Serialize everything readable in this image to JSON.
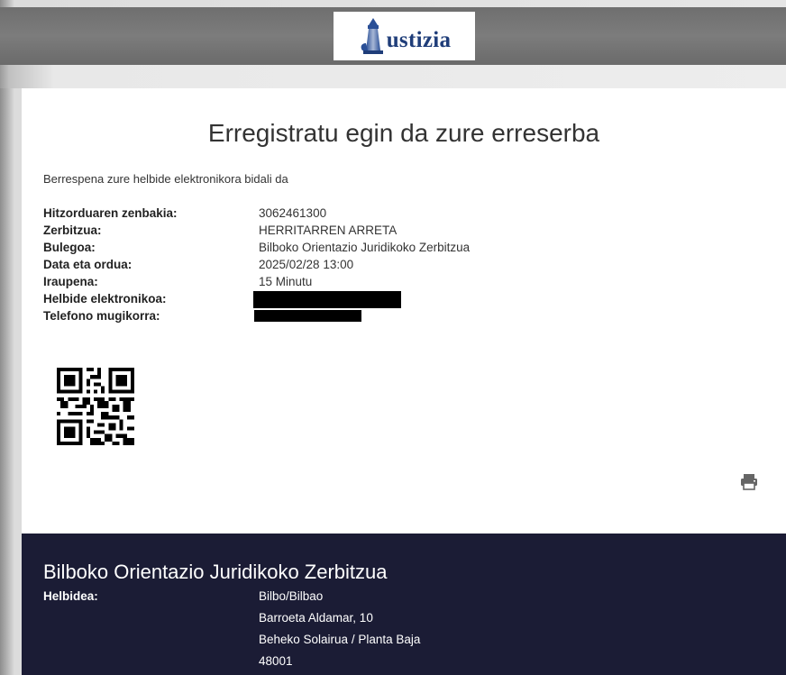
{
  "header": {
    "logo_text": "ustizia",
    "logo_icon": "justice-column-icon"
  },
  "confirmation": {
    "title": "Erregistratu egin da zure erreserba",
    "subtitle": "Berrespena zure helbide elektronikora bidali da",
    "rows": [
      {
        "label": "Hitzorduaren zenbakia:",
        "value": "3062461300"
      },
      {
        "label": "Zerbitzua:",
        "value": "HERRITARREN ARRETA"
      },
      {
        "label": "Bulegoa:",
        "value": "Bilboko Orientazio Juridikoko Zerbitzua"
      },
      {
        "label": "Data eta ordua:",
        "value": "2025/02/28 13:00"
      },
      {
        "label": "Iraupena:",
        "value": "15 Minutu"
      },
      {
        "label": "Helbide elektronikoa:",
        "value": ""
      },
      {
        "label": "Telefono mugikorra:",
        "value": ""
      }
    ],
    "print_icon": "printer-icon"
  },
  "office": {
    "name": "Bilboko Orientazio Juridikoko Zerbitzua",
    "address_label": "Helbidea:",
    "address_lines": [
      "Bilbo/Bilbao",
      "Barroeta Aldamar, 10",
      "Beheko Solairua / Planta Baja",
      "48001"
    ]
  },
  "colors": {
    "footer_bg": "#1b1c35",
    "logo_blue": "#1f3d79",
    "header_gray": "#747474"
  }
}
